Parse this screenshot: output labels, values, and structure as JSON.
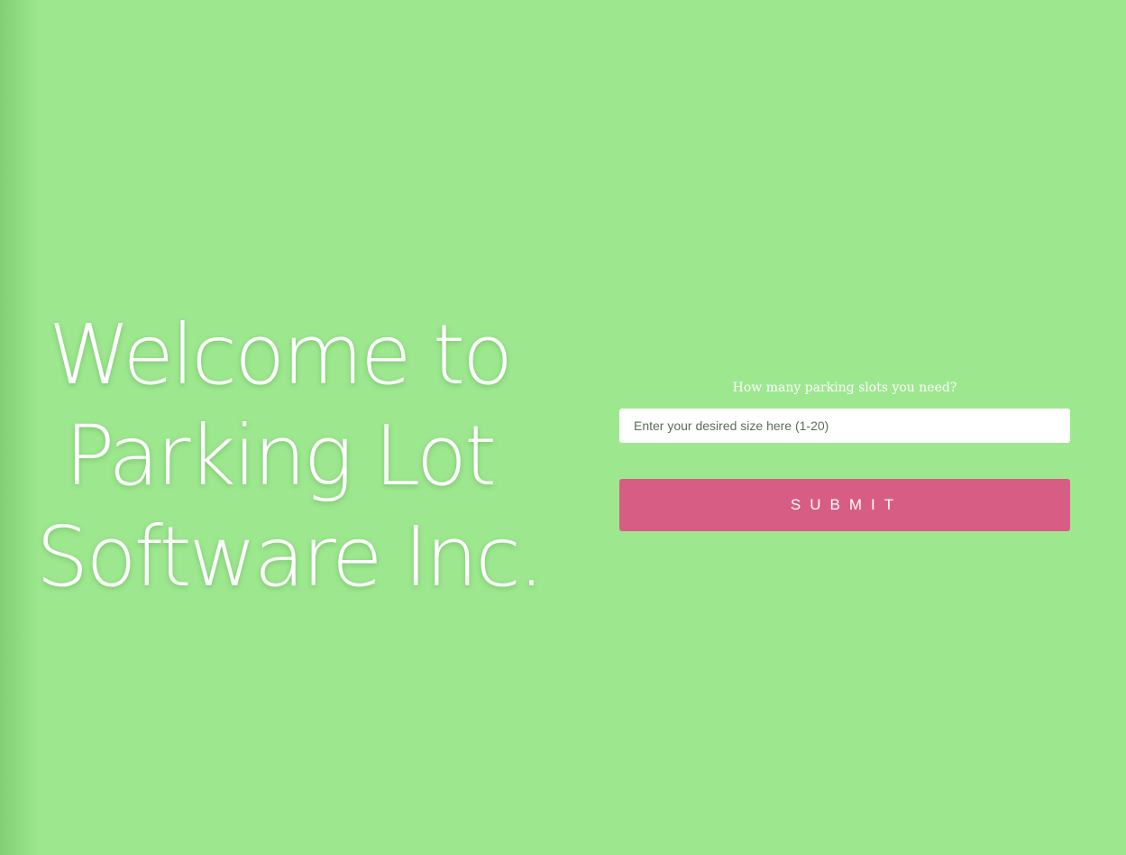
{
  "hero": {
    "lines": [
      "Welcome to",
      "Parking Lot",
      "Software Inc."
    ]
  },
  "form": {
    "question": "How many parking slots you need?",
    "input": {
      "value": "",
      "placeholder": "Enter your desired size here (1-20)"
    },
    "submit_label": "SUBMIT"
  },
  "colors": {
    "background": "#9de88f",
    "submit_button": "#d75d85",
    "text": "#ffffff"
  }
}
